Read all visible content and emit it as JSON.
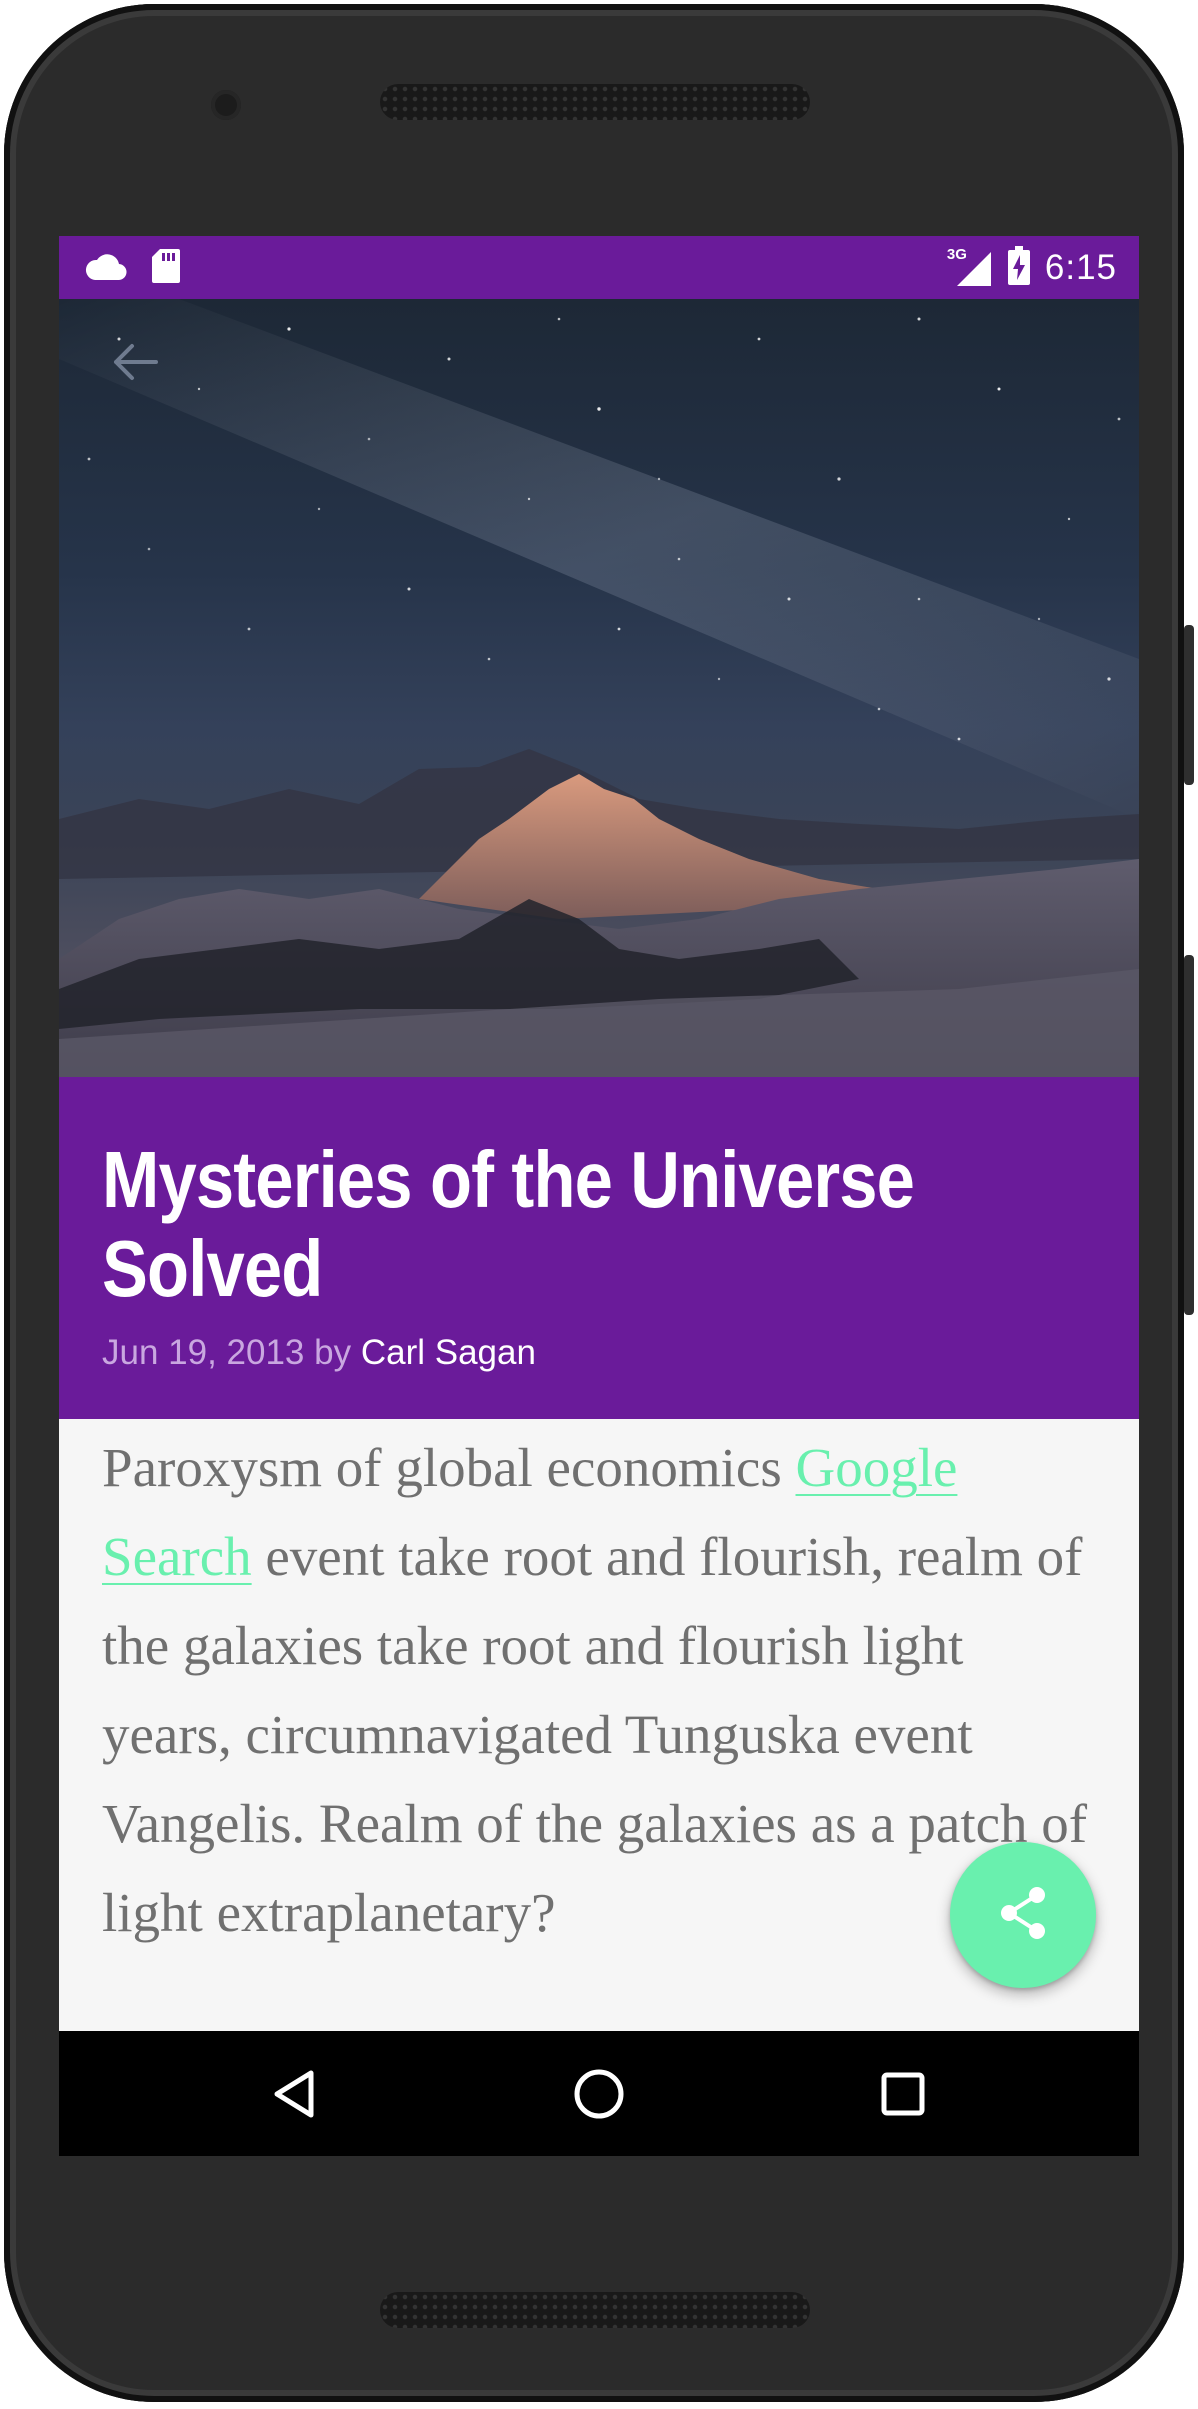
{
  "status_bar": {
    "time": "6:15",
    "network": "3G",
    "icons": [
      "cloud-icon",
      "sd-card-icon",
      "signal-icon",
      "battery-charging-icon"
    ],
    "color": "#6a1b9a"
  },
  "toolbar": {
    "back_icon": "arrow-back-icon"
  },
  "article": {
    "title": "Mysteries of the Universe Solved",
    "date": "Jun 19, 2013",
    "by": "by",
    "author": "Carl Sagan",
    "body_before_link": "Paroxysm of global economics ",
    "link_text": "Google Search",
    "body_after_link": " event take root and flourish, realm of the galaxies take root and flourish light years, circumnavigated Tunguska event Vangelis. Realm of the galaxies as a patch of light extraplanetary?"
  },
  "fab": {
    "icon": "share-icon",
    "color": "#69f0ae"
  },
  "nav_bar": {
    "buttons": [
      "back-triangle-icon",
      "home-circle-icon",
      "recents-square-icon"
    ]
  },
  "colors": {
    "primary": "#6a1b9a",
    "accent": "#69f0ae",
    "body_text": "#707070"
  }
}
